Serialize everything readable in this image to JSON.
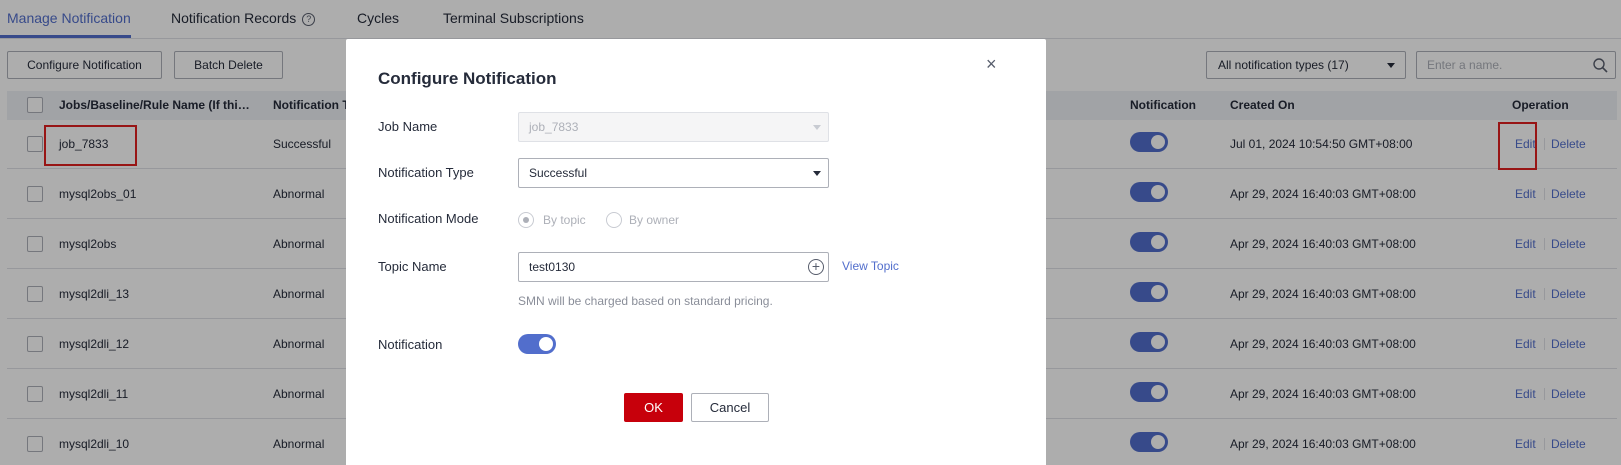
{
  "tabs": [
    {
      "label": "Manage Notification",
      "active": true
    },
    {
      "label": "Notification Records",
      "active": false,
      "help_icon": "?"
    },
    {
      "label": "Cycles",
      "active": false
    },
    {
      "label": "Terminal Subscriptions",
      "active": false
    }
  ],
  "toolbar": {
    "configure_label": "Configure Notification",
    "batch_delete_label": "Batch Delete",
    "type_filter_value": "All notification types (17)",
    "search_placeholder": "Enter a name."
  },
  "table": {
    "headers": {
      "name": "Jobs/Baseline/Rule Name (If thi…",
      "type": "Notification T",
      "notification": "Notification",
      "created": "Created On",
      "operation": "Operation"
    },
    "rows": [
      {
        "name": "job_7833",
        "type": "Successful",
        "notification_on": true,
        "created": "Jul 01, 2024 10:54:50 GMT+08:00",
        "edit": "Edit",
        "delete": "Delete"
      },
      {
        "name": "mysql2obs_01",
        "type": "Abnormal",
        "notification_on": true,
        "created": "Apr 29, 2024 16:40:03 GMT+08:00",
        "edit": "Edit",
        "delete": "Delete"
      },
      {
        "name": "mysql2obs",
        "type": "Abnormal",
        "notification_on": true,
        "created": "Apr 29, 2024 16:40:03 GMT+08:00",
        "edit": "Edit",
        "delete": "Delete"
      },
      {
        "name": "mysql2dli_13",
        "type": "Abnormal",
        "notification_on": true,
        "created": "Apr 29, 2024 16:40:03 GMT+08:00",
        "edit": "Edit",
        "delete": "Delete"
      },
      {
        "name": "mysql2dli_12",
        "type": "Abnormal",
        "notification_on": true,
        "created": "Apr 29, 2024 16:40:03 GMT+08:00",
        "edit": "Edit",
        "delete": "Delete"
      },
      {
        "name": "mysql2dli_11",
        "type": "Abnormal",
        "notification_on": true,
        "created": "Apr 29, 2024 16:40:03 GMT+08:00",
        "edit": "Edit",
        "delete": "Delete"
      },
      {
        "name": "mysql2dli_10",
        "type": "Abnormal",
        "notification_on": true,
        "created": "Apr 29, 2024 16:40:03 GMT+08:00",
        "edit": "Edit",
        "delete": "Delete"
      }
    ]
  },
  "dialog": {
    "title": "Configure Notification",
    "close_icon": "×",
    "job_name_label": "Job Name",
    "job_name_value": "job_7833",
    "notification_type_label": "Notification Type",
    "notification_type_value": "Successful",
    "notification_mode_label": "Notification Mode",
    "mode_options": [
      "By topic",
      "By owner"
    ],
    "mode_selected": "By topic",
    "topic_name_label": "Topic Name",
    "topic_name_value": "test0130",
    "view_topic_label": "View Topic",
    "hint": "SMN will be charged based on standard pricing.",
    "notification_label": "Notification",
    "notification_on": true,
    "ok_label": "OK",
    "cancel_label": "Cancel"
  },
  "colors": {
    "accent": "#526ecc",
    "primary_button": "#c7000b",
    "highlight_box": "#e02020"
  }
}
